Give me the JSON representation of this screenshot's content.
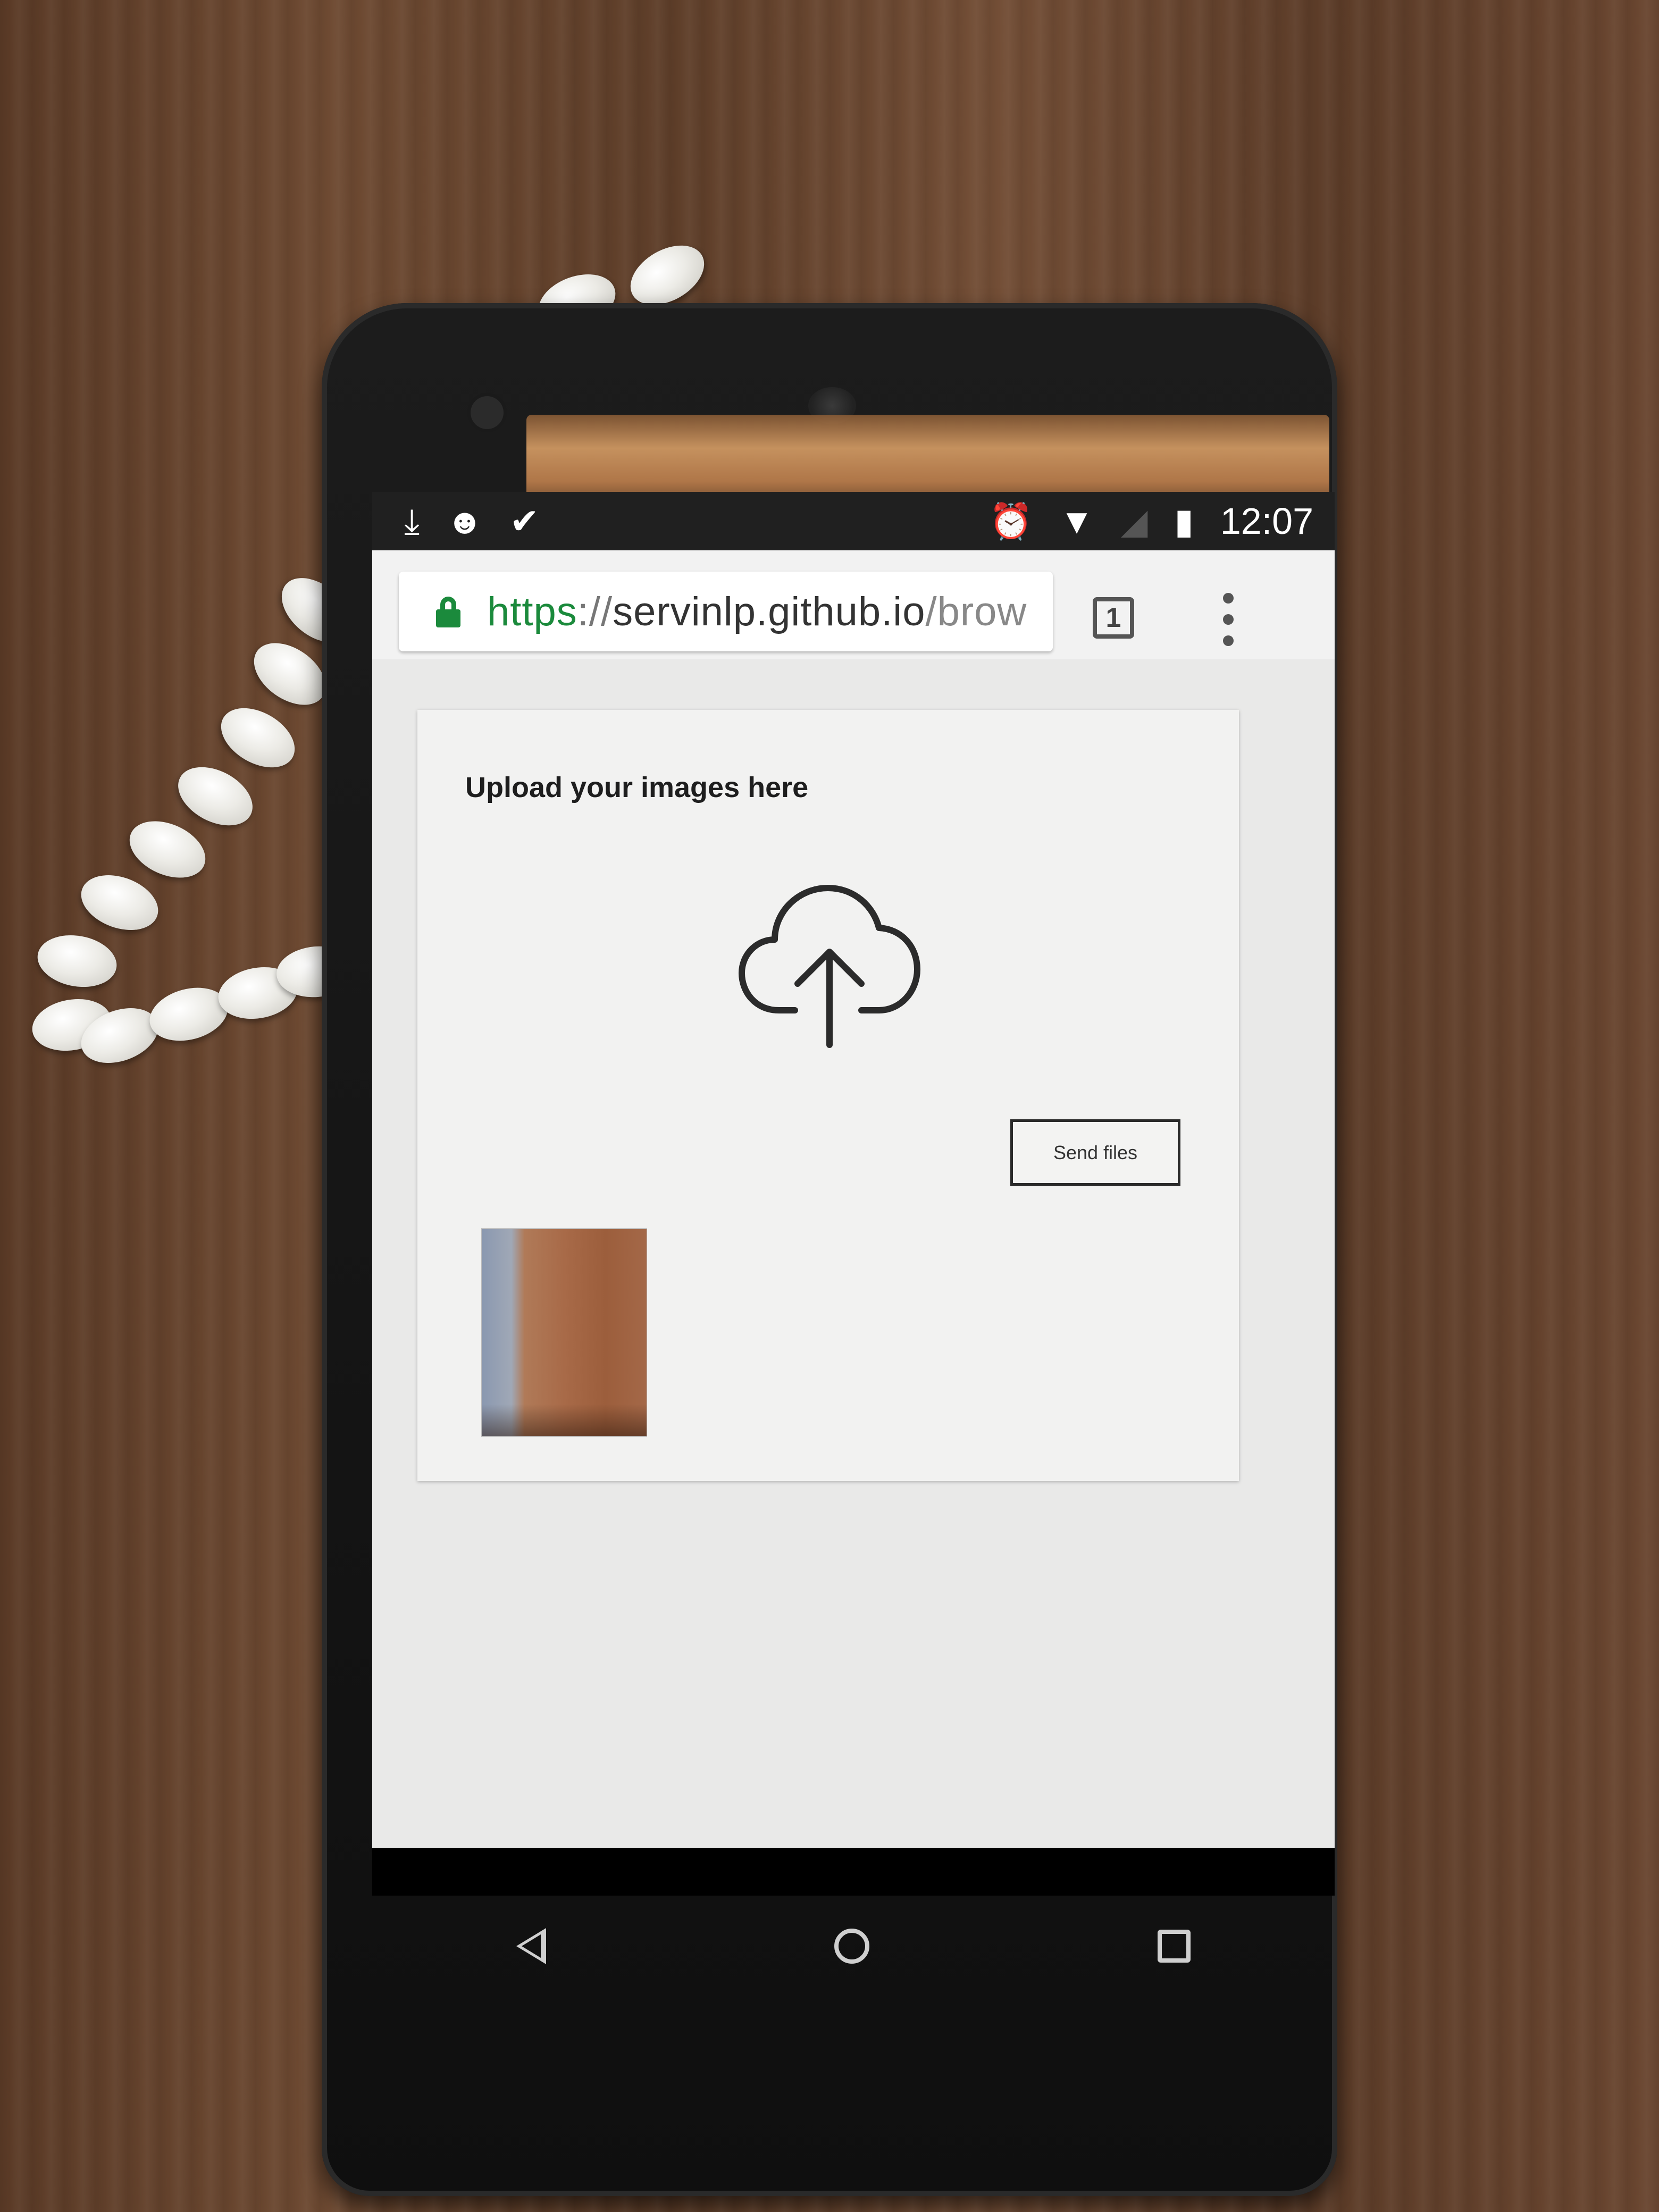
{
  "status_bar": {
    "icons_left": [
      "download-icon",
      "android-icon",
      "checkmark-icon"
    ],
    "icons_right": [
      "alarm-icon",
      "wifi-icon",
      "signal-icon",
      "battery-icon"
    ],
    "time": "12:07"
  },
  "browser": {
    "url": {
      "scheme": "https",
      "separator": "://",
      "host": "servinlp.github.io",
      "path": "/brow"
    },
    "tab_count": "1"
  },
  "page": {
    "title": "Upload your images here",
    "upload_icon": "cloud-upload-icon",
    "send_button_label": "Send files"
  },
  "colors": {
    "secure_green": "#1b8a3c",
    "page_background": "#e9e9e8",
    "card_background": "#f2f2f1"
  }
}
